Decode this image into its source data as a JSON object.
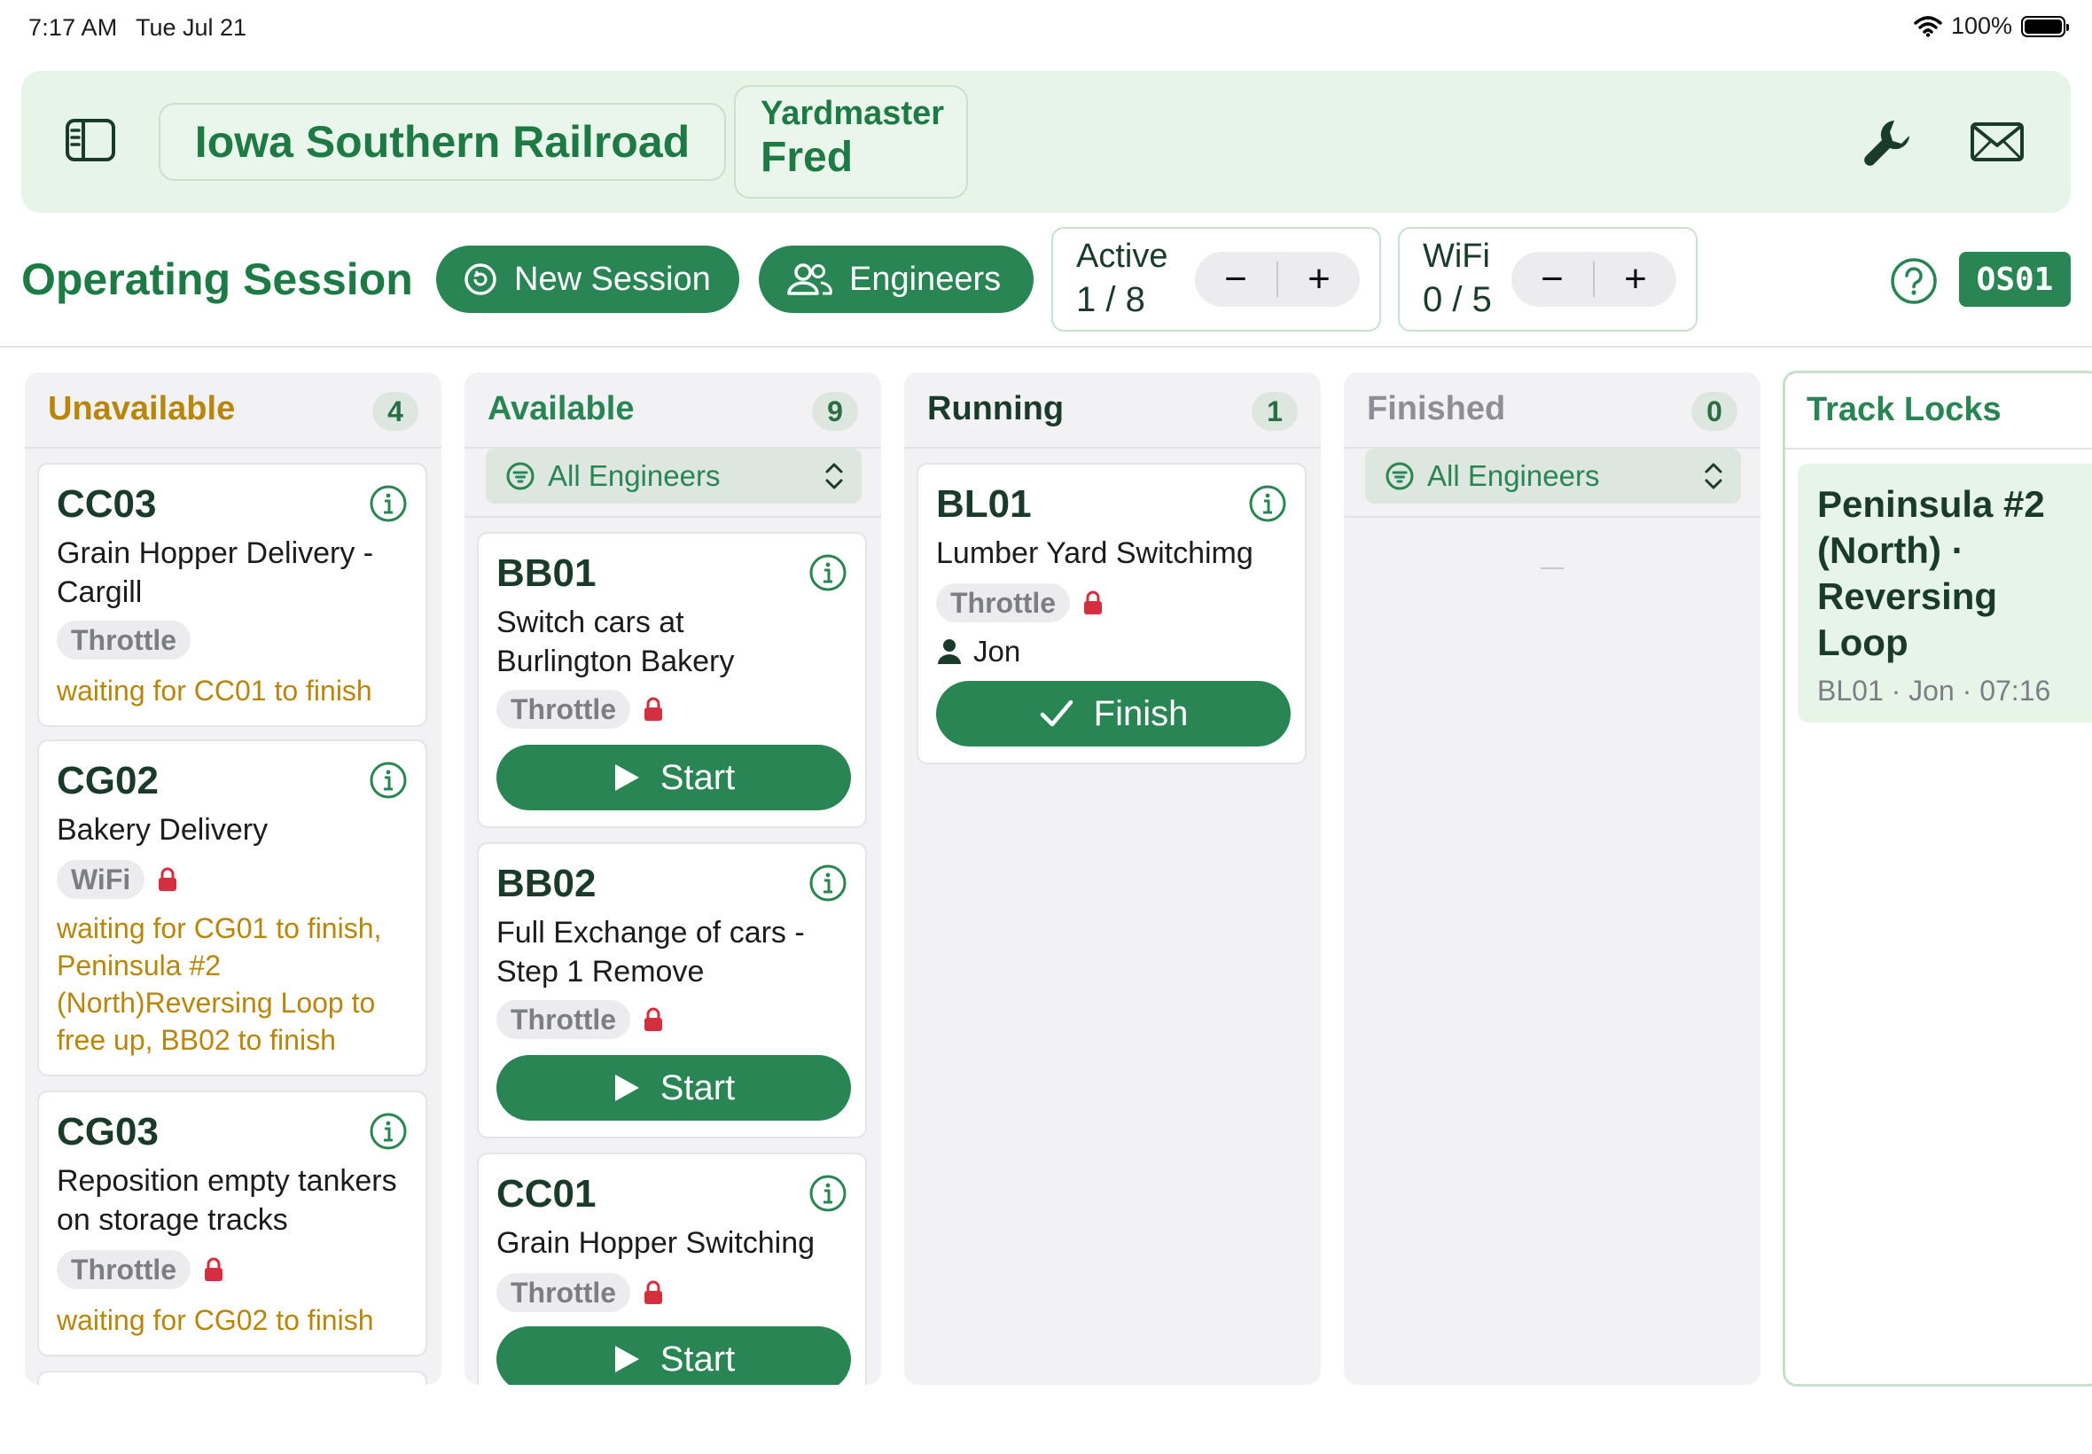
{
  "status_bar": {
    "time": "7:17 AM",
    "date": "Tue Jul 21",
    "battery": "100%"
  },
  "header": {
    "railroad": "Iowa Southern Railroad",
    "role": "Yardmaster",
    "user": "Fred"
  },
  "toolbar": {
    "title": "Operating Session",
    "new_session_label": "New Session",
    "engineers_label": "Engineers",
    "active": {
      "label": "Active",
      "value": "1 / 8"
    },
    "wifi": {
      "label": "WiFi",
      "value": "0 / 5"
    },
    "session_code": "OS01"
  },
  "colors": {
    "brand_green": "#2a8554",
    "warning": "#b8860b",
    "lock_red": "#d32f3f",
    "header_bg": "#e7f4e8"
  },
  "columns": {
    "unavailable": {
      "title": "Unavailable",
      "count": "4",
      "cards": [
        {
          "id": "CC03",
          "desc": "Grain Hopper Delivery - Cargill",
          "tag": "Throttle",
          "locked": false,
          "waiting": "waiting for CC01 to finish"
        },
        {
          "id": "CG02",
          "desc": "Bakery Delivery",
          "tag": "WiFi",
          "locked": true,
          "waiting": "waiting for CG01 to finish, Peninsula #2 (North)Reversing Loop to free up, BB02 to finish"
        },
        {
          "id": "CG03",
          "desc": "Reposition empty tankers on storage tracks",
          "tag": "Throttle",
          "locked": true,
          "waiting": "waiting for CG02 to finish"
        }
      ]
    },
    "available": {
      "title": "Available",
      "count": "9",
      "filter": "All Engineers",
      "button_label": "Start",
      "cards": [
        {
          "id": "BB01",
          "desc": "Switch cars at Burlington Bakery",
          "tag": "Throttle",
          "locked": true
        },
        {
          "id": "BB02",
          "desc": "Full Exchange of cars - Step 1 Remove",
          "tag": "Throttle",
          "locked": true
        },
        {
          "id": "CC01",
          "desc": "Grain Hopper Switching",
          "tag": "Throttle",
          "locked": true
        }
      ]
    },
    "running": {
      "title": "Running",
      "count": "1",
      "button_label": "Finish",
      "cards": [
        {
          "id": "BL01",
          "desc": "Lumber Yard Switchimg",
          "tag": "Throttle",
          "locked": true,
          "engineer": "Jon"
        }
      ]
    },
    "finished": {
      "title": "Finished",
      "count": "0",
      "filter": "All Engineers"
    }
  },
  "track_locks": {
    "title": "Track Locks",
    "items": [
      {
        "track": "Peninsula #2 (North) · Reversing Loop",
        "meta": "BL01 · Jon · 07:16"
      }
    ]
  }
}
